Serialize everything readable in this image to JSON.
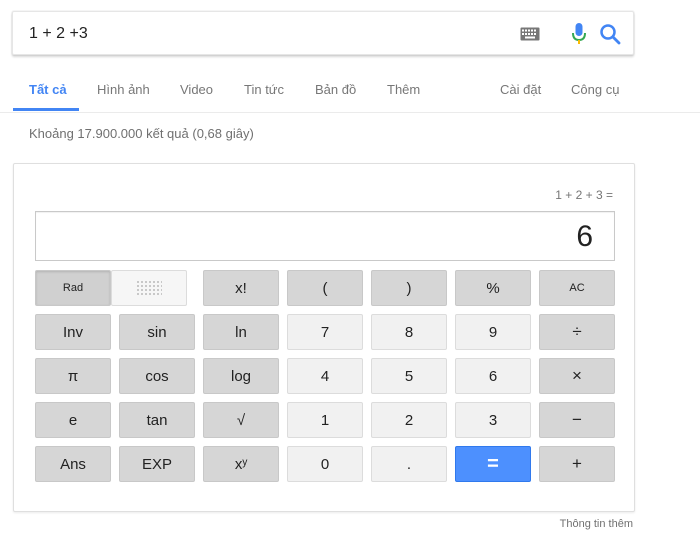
{
  "search": {
    "query": "1 + 2 +3"
  },
  "tabs": {
    "all": "Tất cả",
    "images": "Hình ảnh",
    "video": "Video",
    "news": "Tin tức",
    "maps": "Bản đồ",
    "more": "Thêm",
    "settings": "Cài đặt",
    "tools": "Công cụ"
  },
  "result_stats": "Khoảng 17.900.000 kết quả (0,68 giây)",
  "calculator": {
    "history": "1 + 2 + 3 =",
    "display": "6",
    "keys": {
      "rad": "Rad",
      "factorial": "x!",
      "open_paren": "(",
      "close_paren": ")",
      "percent": "%",
      "ac": "AC",
      "inv": "Inv",
      "sin": "sin",
      "ln": "ln",
      "seven": "7",
      "eight": "8",
      "nine": "9",
      "divide": "÷",
      "pi": "π",
      "cos": "cos",
      "log": "log",
      "four": "4",
      "five": "5",
      "six": "6",
      "multiply": "×",
      "e": "e",
      "tan": "tan",
      "sqrt": "√",
      "one": "1",
      "two": "2",
      "three": "3",
      "minus": "−",
      "ans": "Ans",
      "exp": "EXP",
      "power": "xʸ",
      "zero": "0",
      "dot": ".",
      "equals": "=",
      "plus": "+"
    }
  },
  "more_info": "Thông tin thêm",
  "colors": {
    "accent": "#4285f4",
    "equals_key": "#4d90fe",
    "dark_key": "#d6d6d6",
    "light_key": "#f1f1f1"
  },
  "icons": [
    "keyboard-icon",
    "microphone-icon",
    "search-icon",
    "dot-grid-icon"
  ]
}
